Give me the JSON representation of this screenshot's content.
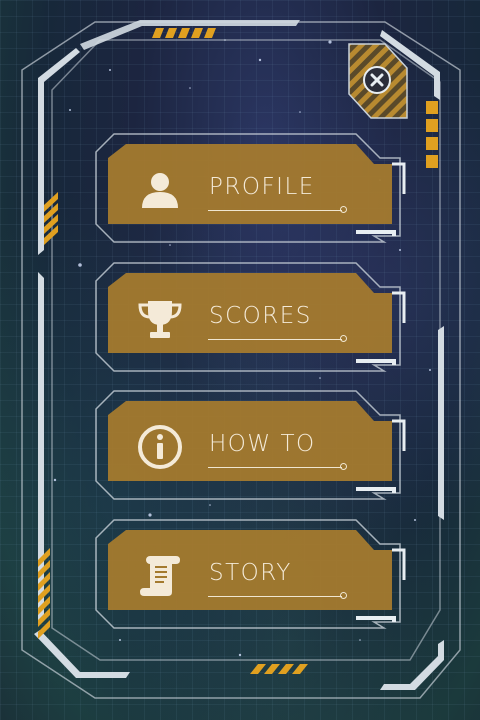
{
  "menu": {
    "items": [
      {
        "label": "PROFILE",
        "icon": "person-icon"
      },
      {
        "label": "SCORES",
        "icon": "trophy-icon"
      },
      {
        "label": "HOW TO",
        "icon": "info-icon"
      },
      {
        "label": "STORY",
        "icon": "scroll-icon"
      }
    ]
  },
  "close": {
    "icon": "close-icon"
  },
  "colors": {
    "button_fill": "#a47a2e",
    "frame": "#c9d2da",
    "accent": "#e0a020"
  }
}
